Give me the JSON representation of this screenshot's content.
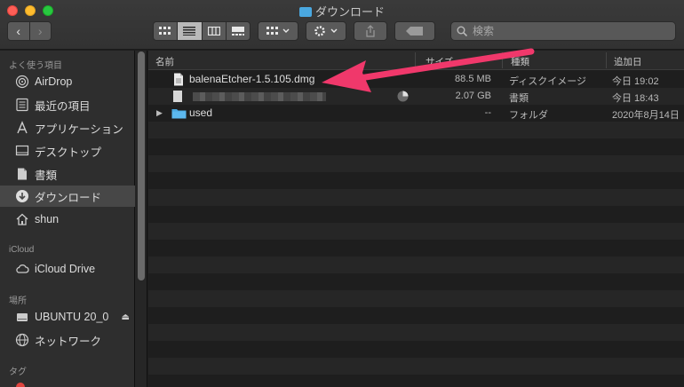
{
  "window": {
    "title": "ダウンロード"
  },
  "toolbar": {
    "back_glyph": "‹",
    "forward_glyph": "›",
    "search_placeholder": "検索"
  },
  "sidebar": {
    "sections": {
      "favorites": "よく使う項目",
      "icloud": "iCloud",
      "locations": "場所",
      "tags": "タグ"
    },
    "favorites": [
      {
        "label": "AirDrop",
        "icon": "airdrop-icon"
      },
      {
        "label": "最近の項目",
        "icon": "recents-icon"
      },
      {
        "label": "アプリケーション",
        "icon": "applications-icon"
      },
      {
        "label": "デスクトップ",
        "icon": "desktop-icon"
      },
      {
        "label": "書類",
        "icon": "documents-icon"
      },
      {
        "label": "ダウンロード",
        "icon": "downloads-icon",
        "selected": true
      },
      {
        "label": "shun",
        "icon": "home-icon"
      }
    ],
    "icloud": [
      {
        "label": "iCloud Drive",
        "icon": "cloud-icon"
      }
    ],
    "locations": [
      {
        "label": "UBUNTU 20_0",
        "icon": "drive-icon"
      },
      {
        "label": "ネットワーク",
        "icon": "network-icon"
      }
    ]
  },
  "list": {
    "columns": {
      "name": "名前",
      "size": "サイズ",
      "kind": "種類",
      "date_added": "追加日"
    },
    "rows": [
      {
        "name": "balenaEtcher-1.5.105.dmg",
        "size": "88.5 MB",
        "kind": "ディスクイメージ",
        "date": "今日 19:02",
        "icon": "document-icon"
      },
      {
        "name": "",
        "size": "2.07 GB",
        "kind": "書類",
        "date": "今日 18:43",
        "icon": "document-icon"
      },
      {
        "name": "used",
        "size": "--",
        "kind": "フォルダ",
        "date": "2020年8月14日",
        "icon": "folder-icon"
      }
    ]
  },
  "colors": {
    "accent_arrow": "#f0386b",
    "folder_blue": "#4aa8e0"
  }
}
